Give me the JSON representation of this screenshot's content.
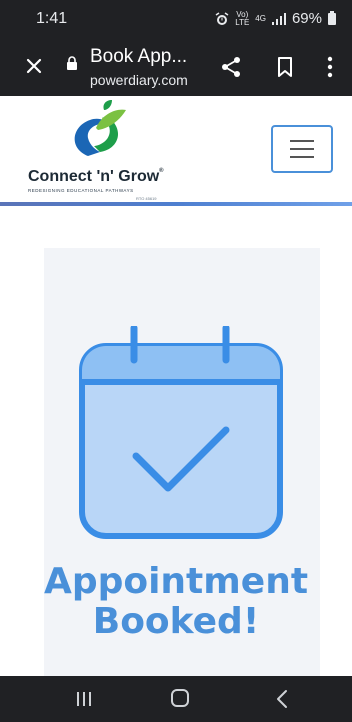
{
  "status_bar": {
    "time": "1:41",
    "network_top": "Vo)",
    "network_bottom": "LTE",
    "signal_type": "4G",
    "battery": "69%",
    "icons": [
      "alarm-icon",
      "signal-icon",
      "battery-icon"
    ]
  },
  "browser": {
    "page_title": "Book App...",
    "domain": "powerdiary.com",
    "icons": [
      "close-icon",
      "lock-icon",
      "share-icon",
      "bookmark-icon",
      "more-vert-icon"
    ]
  },
  "site": {
    "logo_name": "Connect 'n' Grow",
    "logo_registered": "®",
    "logo_tagline": "REDESIGNING EDUCATIONAL PATHWAYS",
    "logo_code": "RTO 45619",
    "brand_colors": {
      "primary": "#4a90d9",
      "logo_green": "#1e9e4a",
      "logo_blue": "#1b66b5"
    }
  },
  "confirmation": {
    "headline": "Appointment Booked!",
    "icon": "calendar-check-icon",
    "accent": "#4a90d9"
  },
  "nav_bar": {
    "icons": [
      "recent-apps-icon",
      "home-icon",
      "back-icon"
    ]
  }
}
